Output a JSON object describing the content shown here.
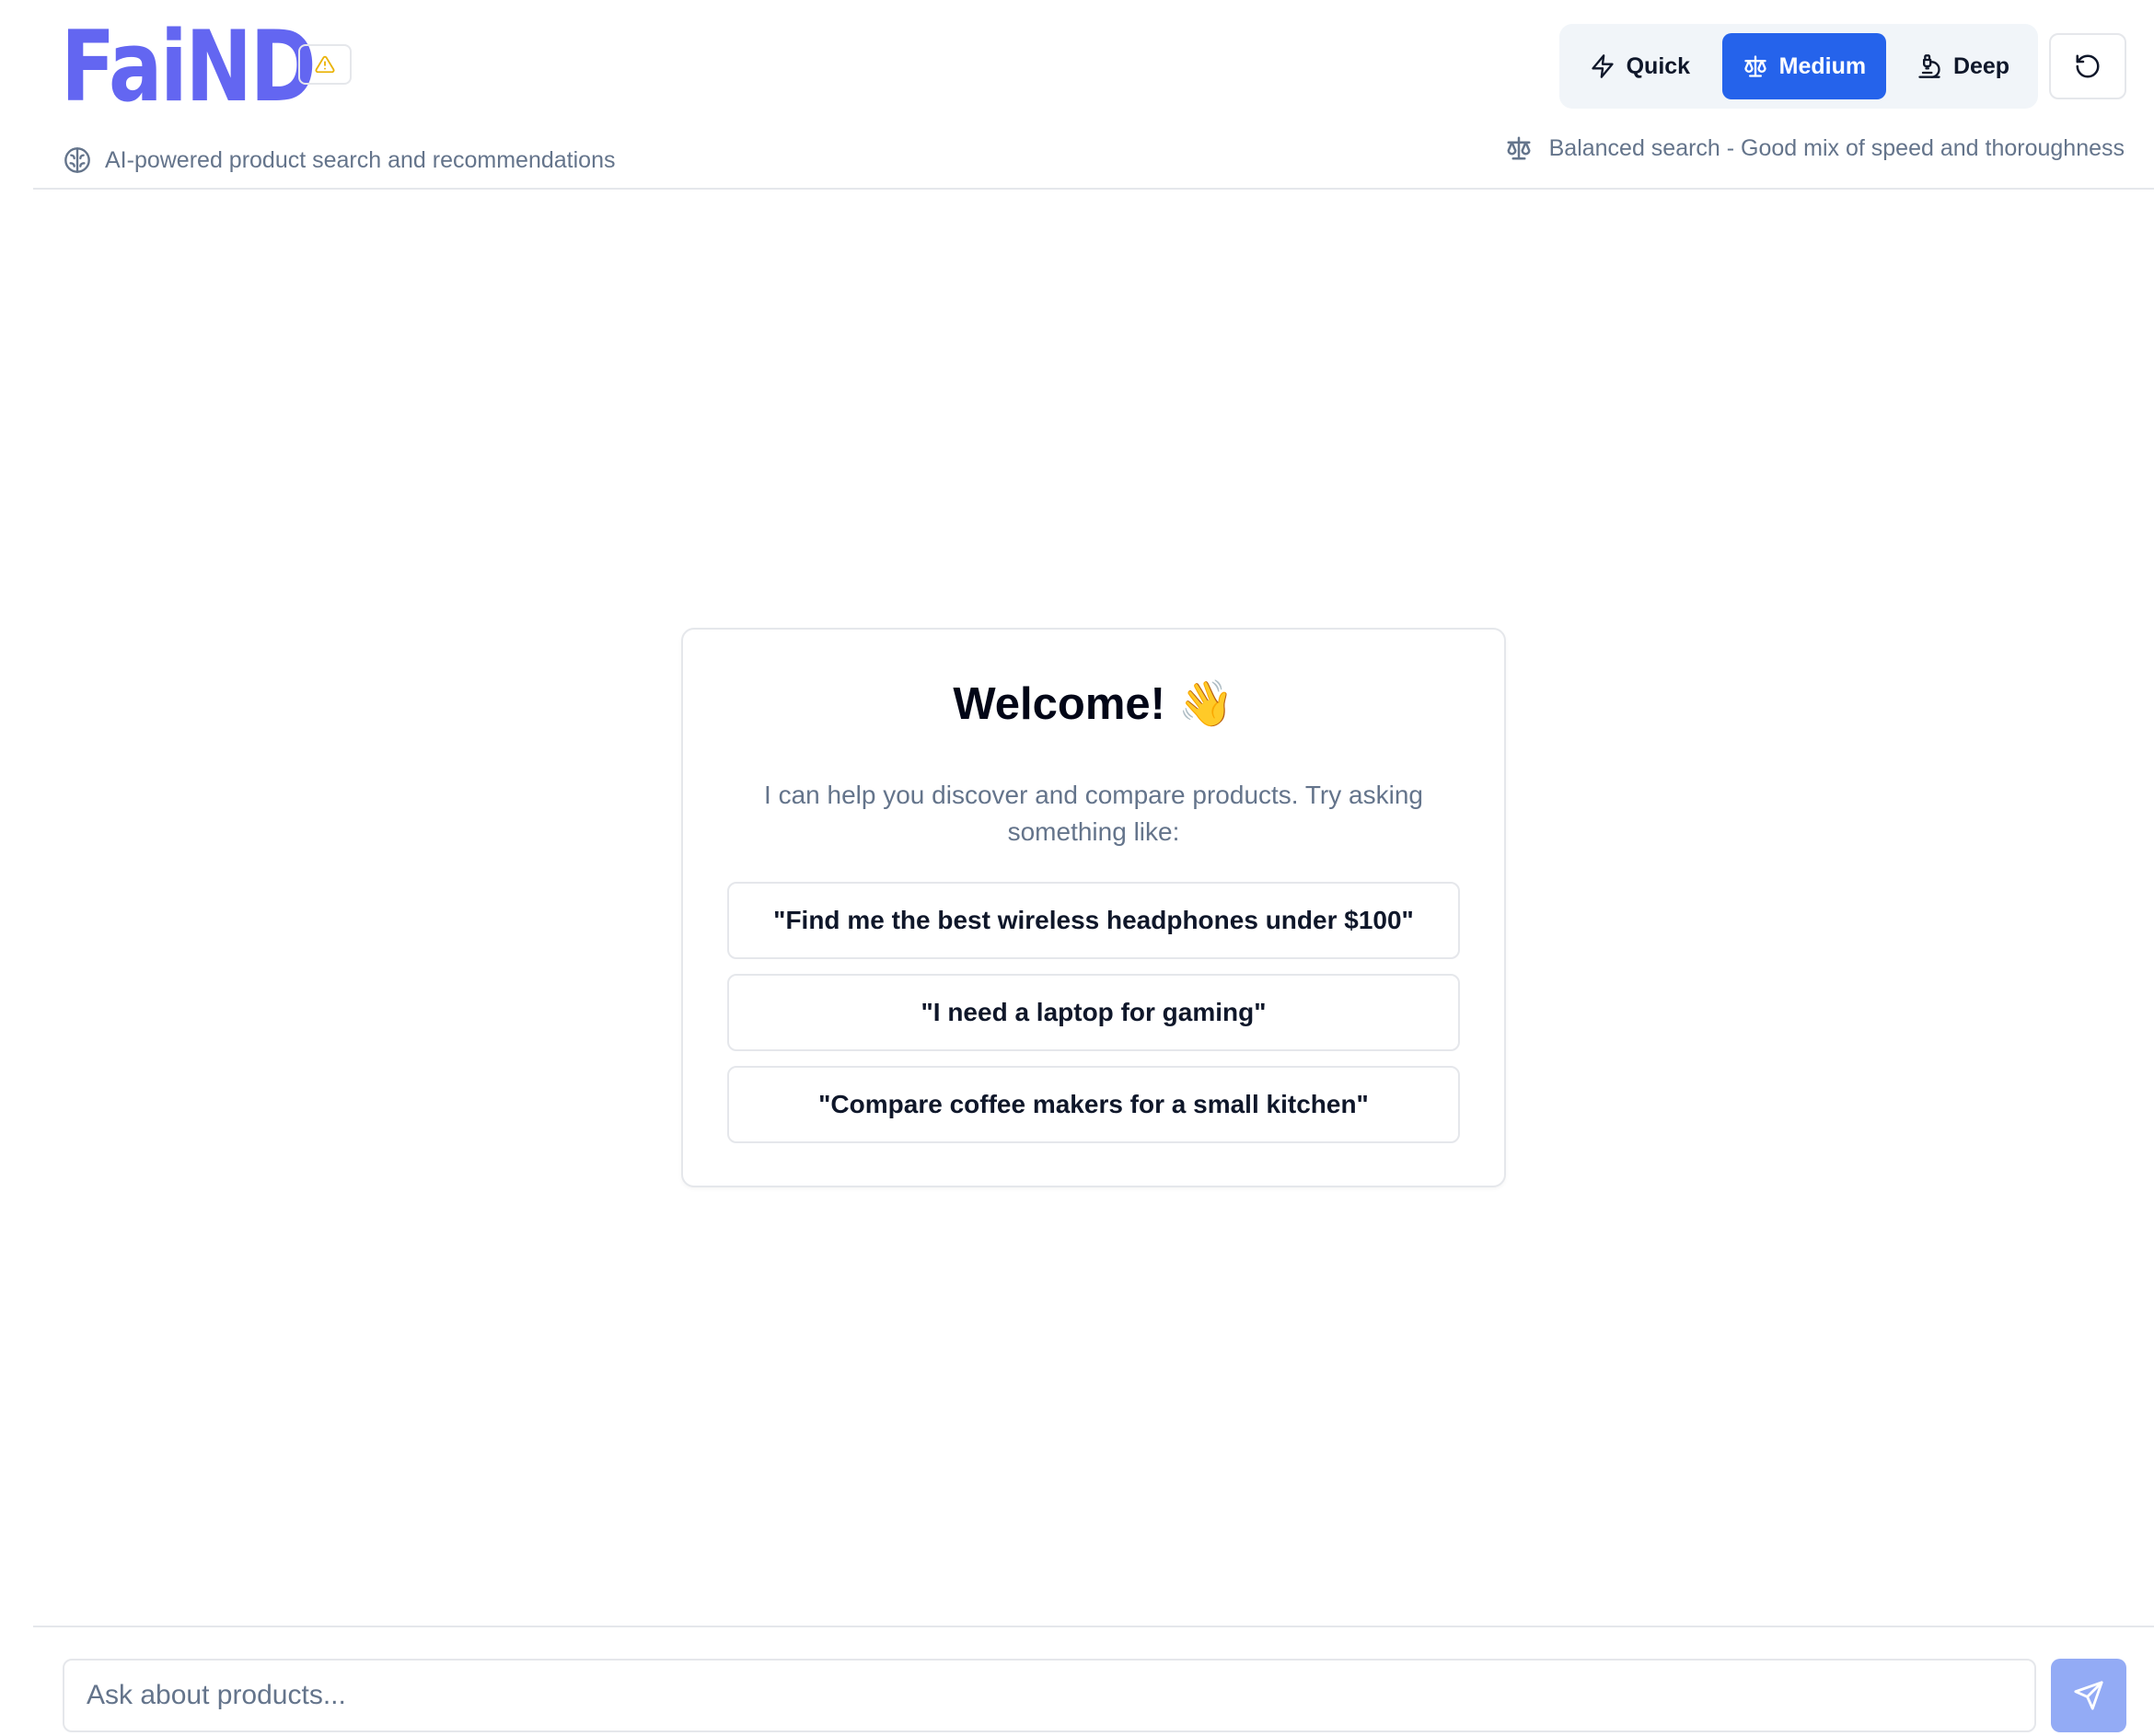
{
  "app": {
    "logo_text": "FaiND",
    "brand_color": "#6366f1"
  },
  "header": {
    "tagline": "AI-powered product search and recommendations",
    "warning_icon": "alert-triangle-icon",
    "modes": [
      {
        "label": "Quick",
        "icon": "zap-icon",
        "active": false
      },
      {
        "label": "Medium",
        "icon": "scale-icon",
        "active": true
      },
      {
        "label": "Deep",
        "icon": "microscope-icon",
        "active": false
      }
    ],
    "reset_icon": "rotate-ccw-icon",
    "mode_description": "Balanced search - Good mix of speed and thoroughness",
    "active_color": "#2563eb"
  },
  "welcome": {
    "title": "Welcome! 👋",
    "text": "I can help you discover and compare products. Try asking something like:",
    "suggestions": [
      "\"Find me the best wireless headphones under $100\"",
      "\"I need a laptop for gaming\"",
      "\"Compare coffee makers for a small kitchen\""
    ]
  },
  "chat": {
    "input_placeholder": "Ask about products...",
    "input_value": "",
    "send_icon": "send-icon"
  }
}
